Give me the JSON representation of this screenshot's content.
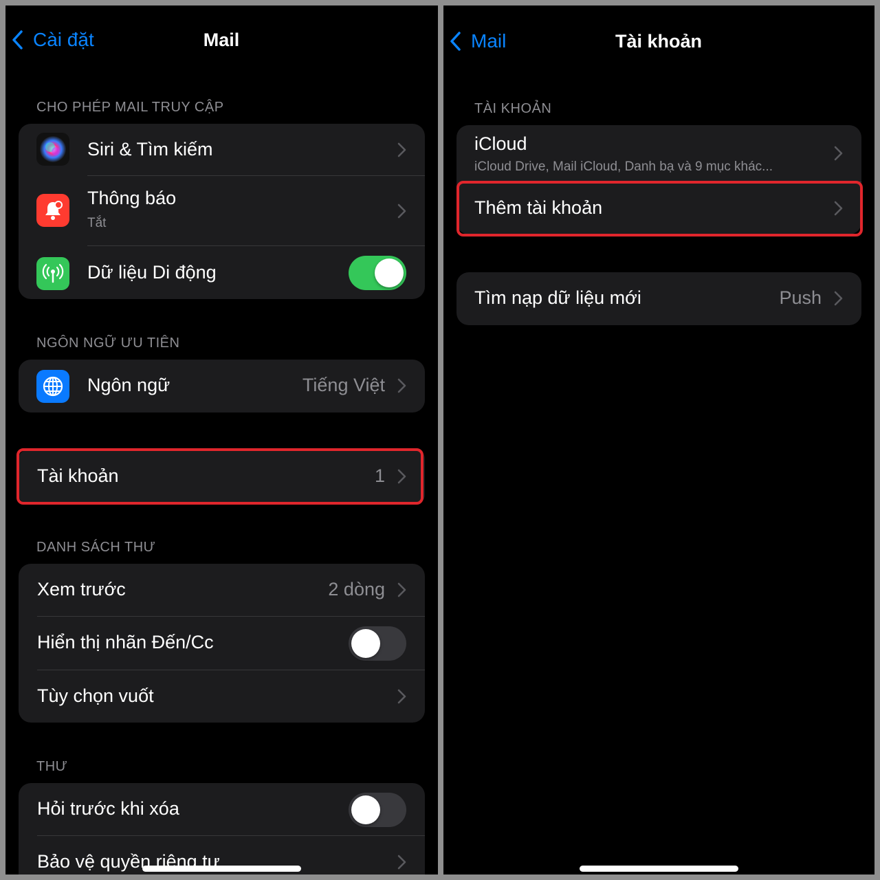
{
  "left": {
    "nav": {
      "back_label": "Cài đặt",
      "title": "Mail"
    },
    "allow_access": {
      "header": "CHO PHÉP MAIL TRUY CẬP",
      "siri_label": "Siri & Tìm kiếm",
      "notifications_label": "Thông báo",
      "notifications_value": "Tắt",
      "cellular_label": "Dữ liệu Di động",
      "cellular_on": true
    },
    "language": {
      "header": "NGÔN NGỮ ƯU TIÊN",
      "label": "Ngôn ngữ",
      "value": "Tiếng Việt"
    },
    "accounts": {
      "label": "Tài khoản",
      "count": "1"
    },
    "message_list": {
      "header": "DANH SÁCH THƯ",
      "preview_label": "Xem trước",
      "preview_value": "2 dòng",
      "show_to_cc_label": "Hiển thị nhãn Đến/Cc",
      "show_to_cc_on": false,
      "swipe_options_label": "Tùy chọn vuốt"
    },
    "messages": {
      "header": "THƯ",
      "ask_before_delete_label": "Hỏi trước khi xóa",
      "ask_before_delete_on": false,
      "privacy_label": "Bảo vệ quyền riêng tư"
    }
  },
  "right": {
    "nav": {
      "back_label": "Mail",
      "title": "Tài khoản"
    },
    "accounts": {
      "header": "TÀI KHOẢN",
      "icloud_label": "iCloud",
      "icloud_detail": "iCloud Drive, Mail iCloud, Danh bạ và 9 mục khác...",
      "add_account_label": "Thêm tài khoản"
    },
    "fetch": {
      "label": "Tìm nạp dữ liệu mới",
      "value": "Push"
    }
  },
  "colors": {
    "accent": "#0a84ff",
    "toggle_on": "#34c759",
    "highlight": "#e0262c",
    "cell_bg": "#1c1c1e",
    "secondary_text": "#8e8e93"
  },
  "icons": {
    "back": "chevron-left-icon",
    "disclosure": "chevron-right-icon",
    "siri": "siri-icon",
    "notifications": "notification-bell-icon",
    "cellular": "cellular-antenna-icon",
    "language": "globe-icon"
  }
}
